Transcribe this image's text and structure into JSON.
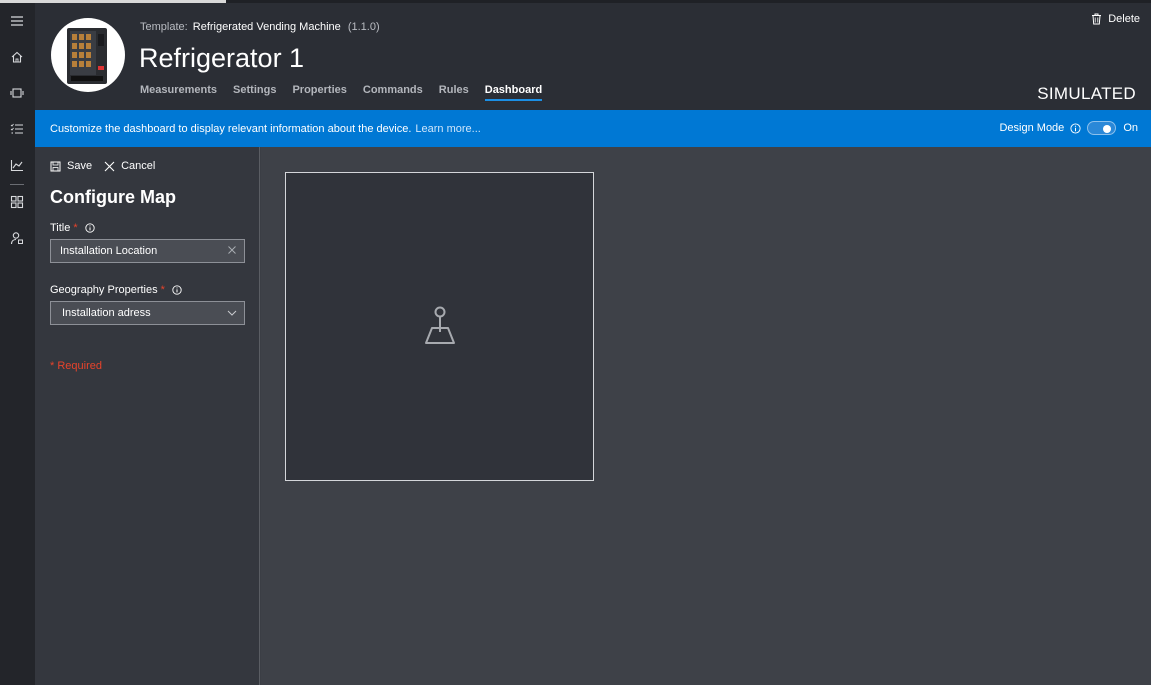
{
  "header": {
    "template_prefix": "Template:",
    "template_name": "Refrigerated Vending Machine",
    "template_version": "(1.1.0)",
    "device_name": "Refrigerator 1",
    "delete_label": "Delete",
    "status": "SIMULATED",
    "tabs": [
      {
        "label": "Measurements",
        "active": false
      },
      {
        "label": "Settings",
        "active": false
      },
      {
        "label": "Properties",
        "active": false
      },
      {
        "label": "Commands",
        "active": false
      },
      {
        "label": "Rules",
        "active": false
      },
      {
        "label": "Dashboard",
        "active": true
      }
    ]
  },
  "banner": {
    "text": "Customize the dashboard to display relevant information about the device.",
    "link": "Learn more...",
    "design_mode_label": "Design Mode",
    "toggle_state": "On"
  },
  "left_nav": {
    "icons": [
      "menu-icon",
      "home-icon",
      "devices-icon",
      "rules-list-icon",
      "analytics-icon",
      "dashboard-grid-icon",
      "admin-user-icon"
    ]
  },
  "panel": {
    "save_label": "Save",
    "cancel_label": "Cancel",
    "title": "Configure Map",
    "title_field_label": "Title",
    "title_field_value": "Installation Location",
    "geo_field_label": "Geography Properties",
    "geo_field_value": "Installation adress",
    "required_note": "* Required"
  },
  "colors": {
    "accent": "#0078d4",
    "required": "#e8432b",
    "header_bg": "#2b2e35",
    "nav_bg": "#23252a"
  }
}
